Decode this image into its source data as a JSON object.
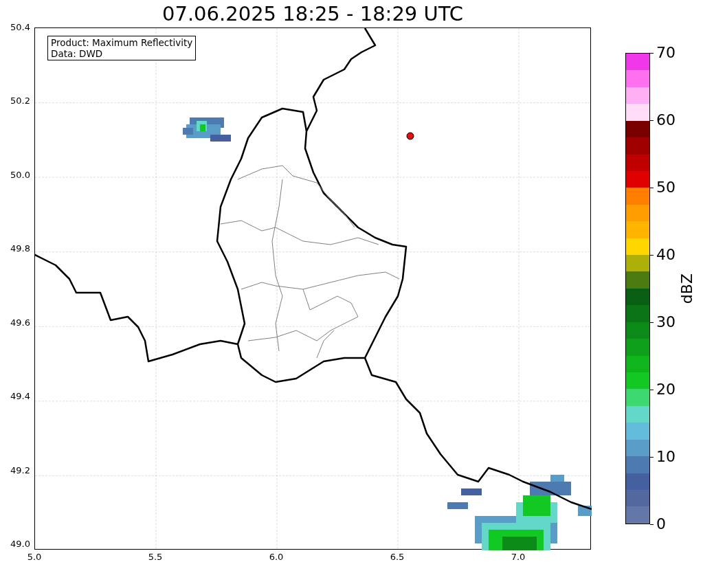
{
  "title": "07.06.2025 18:25 - 18:29 UTC",
  "info_box": {
    "lines": [
      "Product: Maximum Reflectivity",
      "Data: DWD"
    ]
  },
  "x_axis": {
    "ticks": [
      "5.0",
      "5.5",
      "6.0",
      "6.5",
      "7.0"
    ]
  },
  "y_axis": {
    "ticks": [
      "50.4",
      "50.2",
      "50.0",
      "49.8",
      "49.6",
      "49.4",
      "49.2",
      "49.0"
    ]
  },
  "colorbar": {
    "label": "dBZ",
    "ticks": [
      "70",
      "60",
      "50",
      "40",
      "30",
      "20",
      "10",
      "0"
    ],
    "bins": [
      {
        "color": "#f038e8"
      },
      {
        "color": "#ff70f0"
      },
      {
        "color": "#ffb0f4"
      },
      {
        "color": "#ffdcf8"
      },
      {
        "color": "#7a0000"
      },
      {
        "color": "#a00000"
      },
      {
        "color": "#c00000"
      },
      {
        "color": "#e00000"
      },
      {
        "color": "#ff7e00"
      },
      {
        "color": "#ff9c00"
      },
      {
        "color": "#ffb400"
      },
      {
        "color": "#ffd700"
      },
      {
        "color": "#aeb00a"
      },
      {
        "color": "#4a7a10"
      },
      {
        "color": "#0a5e14"
      },
      {
        "color": "#0b7417"
      },
      {
        "color": "#0c8a18"
      },
      {
        "color": "#0ea01a"
      },
      {
        "color": "#10b41c"
      },
      {
        "color": "#12c822"
      },
      {
        "color": "#3ed870"
      },
      {
        "color": "#63d8c8"
      },
      {
        "color": "#63bcdc"
      },
      {
        "color": "#5a9cc8"
      },
      {
        "color": "#4d7ab0"
      },
      {
        "color": "#4560a0"
      },
      {
        "color": "#5468a0"
      },
      {
        "color": "#6577a8"
      }
    ]
  }
}
